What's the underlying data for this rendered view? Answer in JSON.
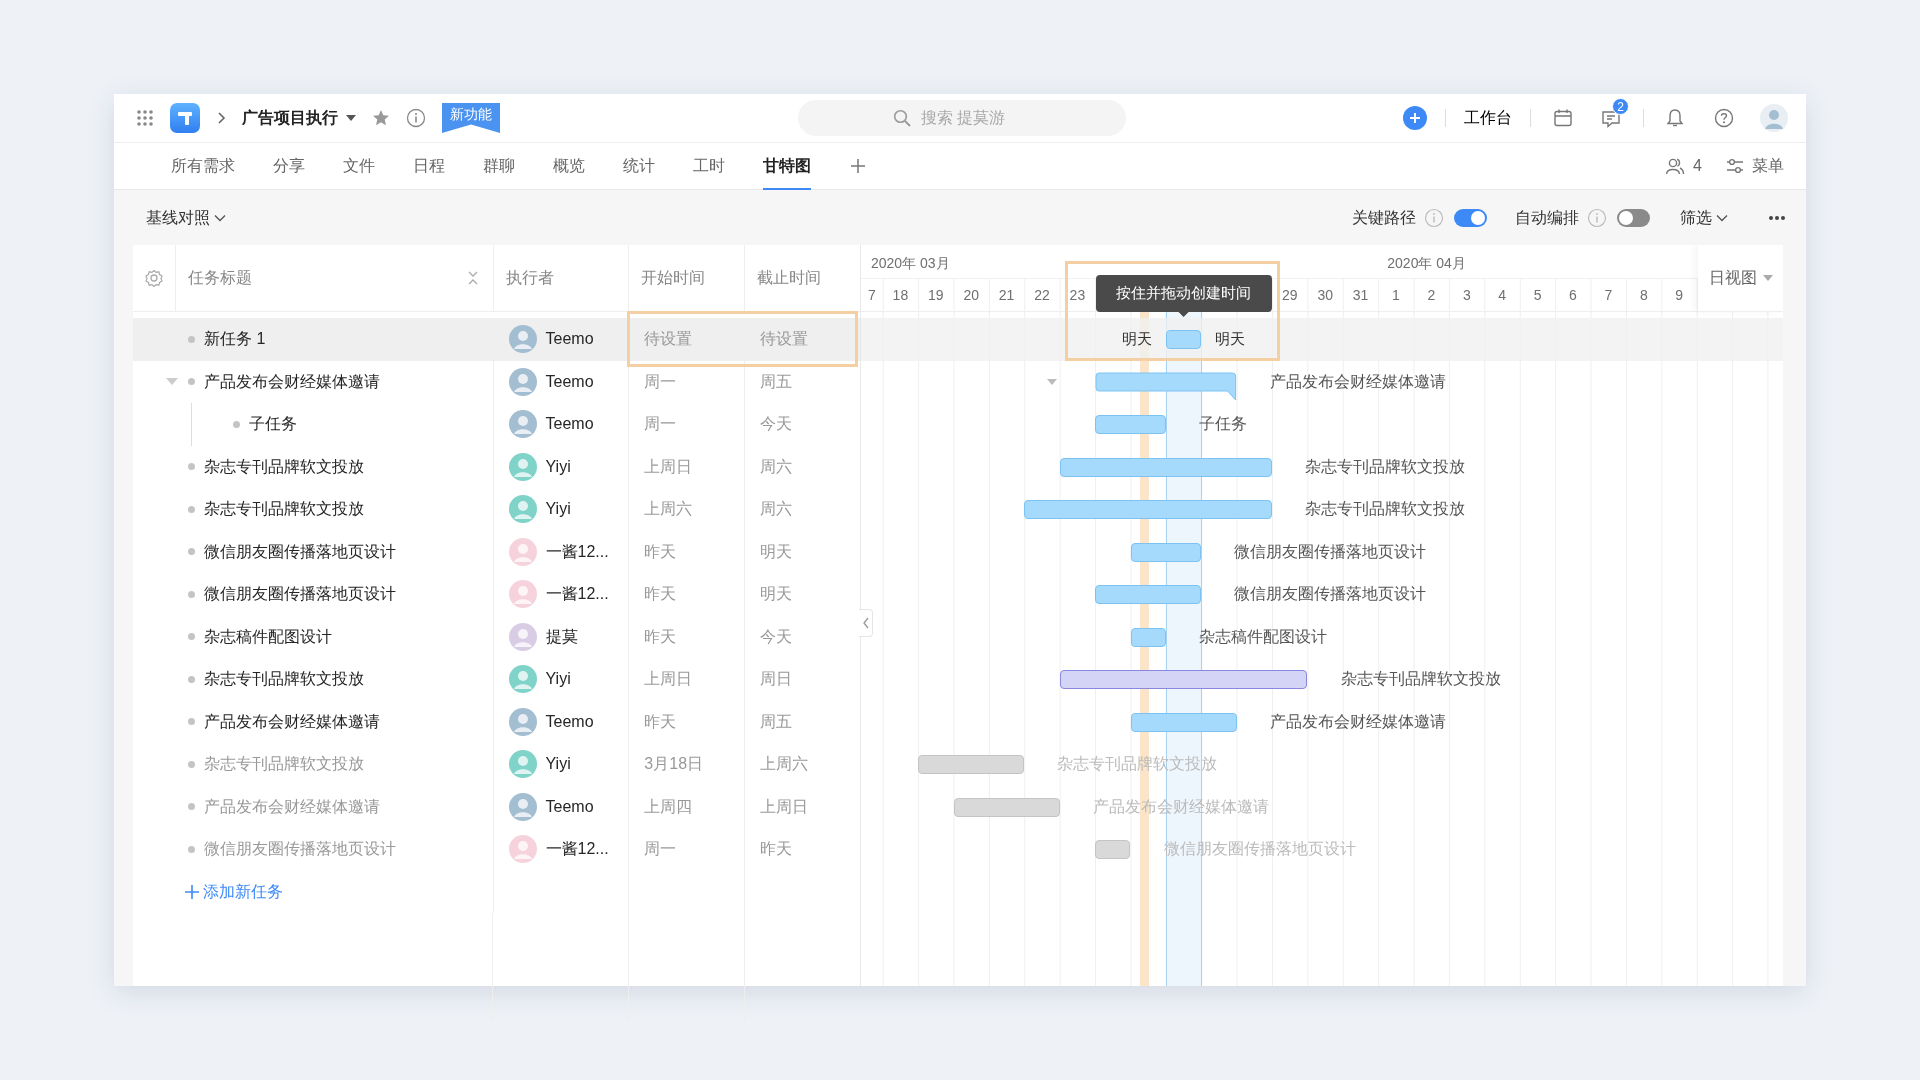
{
  "topbar": {
    "project_title": "广告项目执行",
    "new_feature_badge": "新功能",
    "search": {
      "placeholder": "搜索 提莫游"
    },
    "workbench": "工作台",
    "message_count": "2"
  },
  "tabs": [
    {
      "label": "所有需求",
      "selected": false
    },
    {
      "label": "分享",
      "selected": false
    },
    {
      "label": "文件",
      "selected": false
    },
    {
      "label": "日程",
      "selected": false
    },
    {
      "label": "群聊",
      "selected": false
    },
    {
      "label": "概览",
      "selected": false
    },
    {
      "label": "统计",
      "selected": false
    },
    {
      "label": "工时",
      "selected": false
    },
    {
      "label": "甘特图",
      "selected": true
    }
  ],
  "tab_tools": {
    "member_count": "4",
    "menu": "菜单"
  },
  "toolbar": {
    "baseline": "基线对照",
    "switches": [
      {
        "label": "关键路径",
        "on": true
      },
      {
        "label": "自动编排",
        "on": false
      }
    ],
    "filter": "筛选"
  },
  "table": {
    "columns": [
      "任务标题",
      "执行者",
      "开始时间",
      "截止时间"
    ],
    "tasks": [
      {
        "title": "新任务 1",
        "muted": false,
        "selected": true,
        "assignee": {
          "name": "Teemo",
          "color": "#a3bdd1"
        },
        "start": "待设置",
        "due": "待设置",
        "color": "#a6dafc",
        "date_labels": [
          "明天",
          "明天"
        ]
      },
      {
        "title": "产品发布会财经媒体邀请",
        "muted": false,
        "selected": false,
        "expanded": true,
        "assignee": {
          "name": "Teemo",
          "color": "#a3bdd1"
        },
        "start": "周一",
        "due": "周五",
        "color": "#a6dafc",
        "bar_label": "产品发布会财经媒体邀请",
        "children": [
          {
            "title": "子任务",
            "muted": false,
            "selected": false,
            "assignee": {
              "name": "Teemo",
              "color": "#a3bdd1"
            },
            "start": "周一",
            "due": "今天",
            "color": "#a6dafc",
            "bar_label": "子任务"
          }
        ]
      },
      {
        "title": "杂志专刊品牌软文投放",
        "muted": false,
        "selected": false,
        "assignee": {
          "name": "Yiyi",
          "color": "#7fd3c9"
        },
        "start": "上周日",
        "due": "周六",
        "color": "#a6dafc",
        "bar_label": "杂志专刊品牌软文投放"
      },
      {
        "title": "杂志专刊品牌软文投放",
        "muted": false,
        "selected": false,
        "assignee": {
          "name": "Yiyi",
          "color": "#7fd3c9"
        },
        "start": "上周六",
        "due": "周六",
        "color": "#a6dafc",
        "bar_label": "杂志专刊品牌软文投放"
      },
      {
        "title": "微信朋友圈传播落地页设计",
        "muted": false,
        "selected": false,
        "assignee": {
          "name": "一酱12...",
          "color": "#f6d3dc"
        },
        "start": "昨天",
        "due": "明天",
        "color": "#a6dafc",
        "bar_label": "微信朋友圈传播落地页设计"
      },
      {
        "title": "微信朋友圈传播落地页设计",
        "muted": false,
        "selected": false,
        "assignee": {
          "name": "一酱12...",
          "color": "#f6d3dc"
        },
        "start": "昨天",
        "due": "明天",
        "color": "#a6dafc",
        "bar_label": "微信朋友圈传播落地页设计"
      },
      {
        "title": "杂志稿件配图设计",
        "muted": false,
        "selected": false,
        "assignee": {
          "name": "提莫",
          "color": "#d9cde6"
        },
        "start": "昨天",
        "due": "今天",
        "color": "#a6dafc",
        "bar_label": "杂志稿件配图设计"
      },
      {
        "title": "杂志专刊品牌软文投放",
        "muted": false,
        "selected": false,
        "assignee": {
          "name": "Yiyi",
          "color": "#7fd3c9"
        },
        "start": "上周日",
        "due": "周日",
        "color": "#d4d5f6",
        "bar_label": "杂志专刊品牌软文投放"
      },
      {
        "title": "产品发布会财经媒体邀请",
        "muted": false,
        "selected": false,
        "assignee": {
          "name": "Teemo",
          "color": "#a3bdd1"
        },
        "start": "昨天",
        "due": "周五",
        "color": "#a6dafc",
        "bar_label": "产品发布会财经媒体邀请"
      },
      {
        "title": "杂志专刊品牌软文投放",
        "muted": true,
        "selected": false,
        "assignee": {
          "name": "Yiyi",
          "color": "#7fd3c9"
        },
        "start": "3月18日",
        "due": "上周六",
        "color": "#d9d9d9",
        "bar_label": "杂志专刊品牌软文投放"
      },
      {
        "title": "产品发布会财经媒体邀请",
        "muted": true,
        "selected": false,
        "assignee": {
          "name": "Teemo",
          "color": "#a3bdd1"
        },
        "start": "上周四",
        "due": "上周日",
        "color": "#d9d9d9",
        "bar_label": "产品发布会财经媒体邀请"
      },
      {
        "title": "微信朋友圈传播落地页设计",
        "muted": true,
        "selected": false,
        "assignee": {
          "name": "一酱12...",
          "color": "#f6d3dc"
        },
        "start": "周一",
        "due": "昨天",
        "color": "#d9d9d9",
        "bar_label": "微信朋友圈传播落地页设计"
      }
    ],
    "add_task": "添加新任务"
  },
  "gantt": {
    "view": "日视图",
    "tooltip": "按住并拖动创建时间",
    "months": [
      {
        "label": "2020年 03月",
        "days": [
          "7",
          "18",
          "19",
          "20",
          "21",
          "22",
          "23",
          "29",
          "30",
          "31"
        ]
      },
      {
        "label": "2020年 04月",
        "days": [
          "1",
          "2",
          "3",
          "4",
          "5",
          "6",
          "7",
          "8",
          "9"
        ]
      }
    ]
  }
}
